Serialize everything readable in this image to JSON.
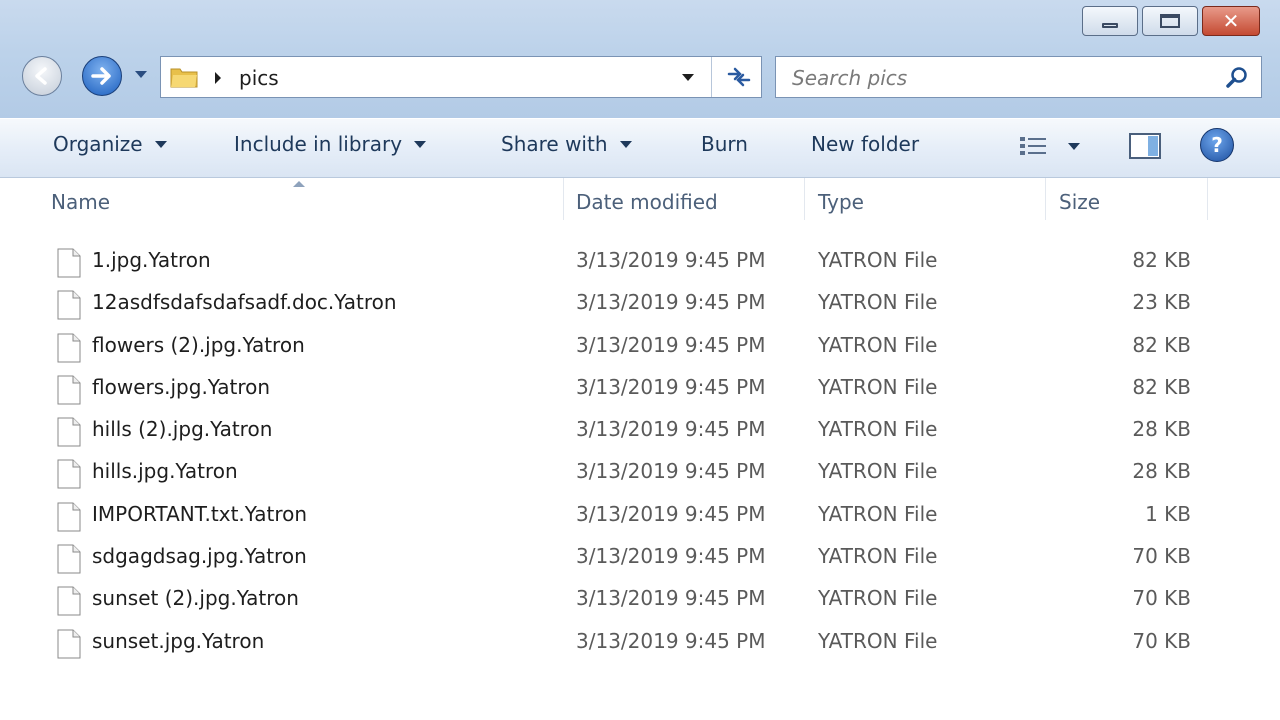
{
  "address": {
    "crumb": "pics"
  },
  "search": {
    "placeholder": "Search pics"
  },
  "toolbar": {
    "organize": "Organize",
    "include": "Include in library",
    "share": "Share with",
    "burn": "Burn",
    "new_folder": "New folder"
  },
  "columns": {
    "name": "Name",
    "date": "Date modified",
    "type": "Type",
    "size": "Size"
  },
  "files": [
    {
      "name": "1.jpg.Yatron",
      "date": "3/13/2019 9:45 PM",
      "type": "YATRON File",
      "size": "82 KB"
    },
    {
      "name": "12asdfsdafsdafsadf.doc.Yatron",
      "date": "3/13/2019 9:45 PM",
      "type": "YATRON File",
      "size": "23 KB"
    },
    {
      "name": "flowers (2).jpg.Yatron",
      "date": "3/13/2019 9:45 PM",
      "type": "YATRON File",
      "size": "82 KB"
    },
    {
      "name": "flowers.jpg.Yatron",
      "date": "3/13/2019 9:45 PM",
      "type": "YATRON File",
      "size": "82 KB"
    },
    {
      "name": "hills (2).jpg.Yatron",
      "date": "3/13/2019 9:45 PM",
      "type": "YATRON File",
      "size": "28 KB"
    },
    {
      "name": "hills.jpg.Yatron",
      "date": "3/13/2019 9:45 PM",
      "type": "YATRON File",
      "size": "28 KB"
    },
    {
      "name": "IMPORTANT.txt.Yatron",
      "date": "3/13/2019 9:45 PM",
      "type": "YATRON File",
      "size": "1 KB"
    },
    {
      "name": "sdgagdsag.jpg.Yatron",
      "date": "3/13/2019 9:45 PM",
      "type": "YATRON File",
      "size": "70 KB"
    },
    {
      "name": "sunset (2).jpg.Yatron",
      "date": "3/13/2019 9:45 PM",
      "type": "YATRON File",
      "size": "70 KB"
    },
    {
      "name": "sunset.jpg.Yatron",
      "date": "3/13/2019 9:45 PM",
      "type": "YATRON File",
      "size": "70 KB"
    }
  ],
  "icons": {
    "back": "back-arrow-icon",
    "forward": "forward-arrow-icon",
    "folder": "folder-icon",
    "refresh": "refresh-icon",
    "search": "search-icon",
    "file": "file-icon",
    "views": "view-options-icon",
    "pane": "preview-pane-icon",
    "help": "help-icon"
  },
  "colors": {
    "frame": "#bcd2ea",
    "command_text": "#1e395b",
    "header_text": "#4c607a",
    "close": "#c44a32"
  }
}
